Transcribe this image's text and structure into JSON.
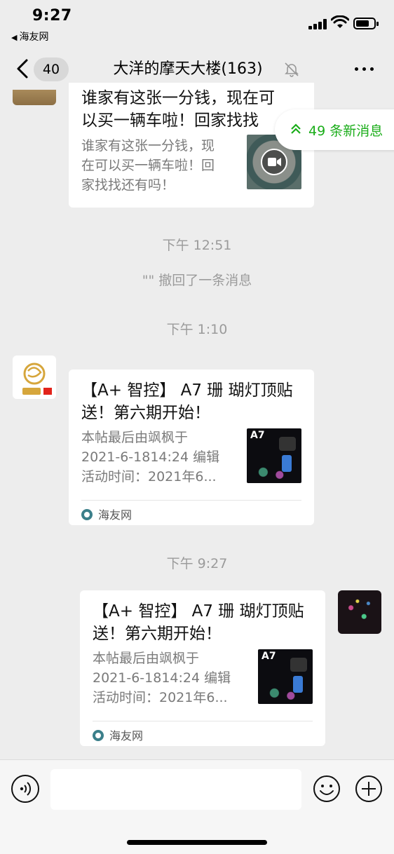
{
  "status": {
    "time": "9:27",
    "back_app": "海友网"
  },
  "nav": {
    "unread_count": "40",
    "title": "大洋的摩天大楼(163)"
  },
  "new_messages": {
    "label": "49 条新消息"
  },
  "messages": [
    {
      "type": "card",
      "title_lines": [
        "谁家有这张一分钱，现在可",
        "以买一辆车啦！回家找找"
      ],
      "desc_lines": [
        "谁家有这张一分钱，现",
        "在可以买一辆车啦！回",
        "家找找还有吗！"
      ],
      "thumb": "coin-video-thumbnail"
    },
    {
      "type": "time",
      "text": "下午 12:51"
    },
    {
      "type": "recall",
      "text": "\"\" 撤回了一条消息"
    },
    {
      "type": "time",
      "text": "下午 1:10"
    },
    {
      "type": "card",
      "title_lines": [
        "【A+ 智控】 A7 珊 瑚灯顶贴",
        "送！第六期开始！"
      ],
      "desc_lines": [
        "本帖最后由飒枫于",
        "2021-6-1814:24 编辑",
        "活动时间：2021年6..."
      ],
      "thumb_label": "A7",
      "source": "海友网"
    },
    {
      "type": "time",
      "text": "下午 9:27"
    },
    {
      "type": "card",
      "title_lines": [
        "【A+ 智控】 A7 珊 瑚灯顶贴",
        "送！第六期开始！"
      ],
      "desc_lines": [
        "本帖最后由飒枫于",
        "2021-6-1814:24 编辑",
        "活动时间：2021年6..."
      ],
      "thumb_label": "A7",
      "source": "海友网"
    }
  ],
  "colors": {
    "background": "#ededed",
    "accent_green": "#1aad19",
    "timestamp_gray": "#9b9b9b"
  }
}
